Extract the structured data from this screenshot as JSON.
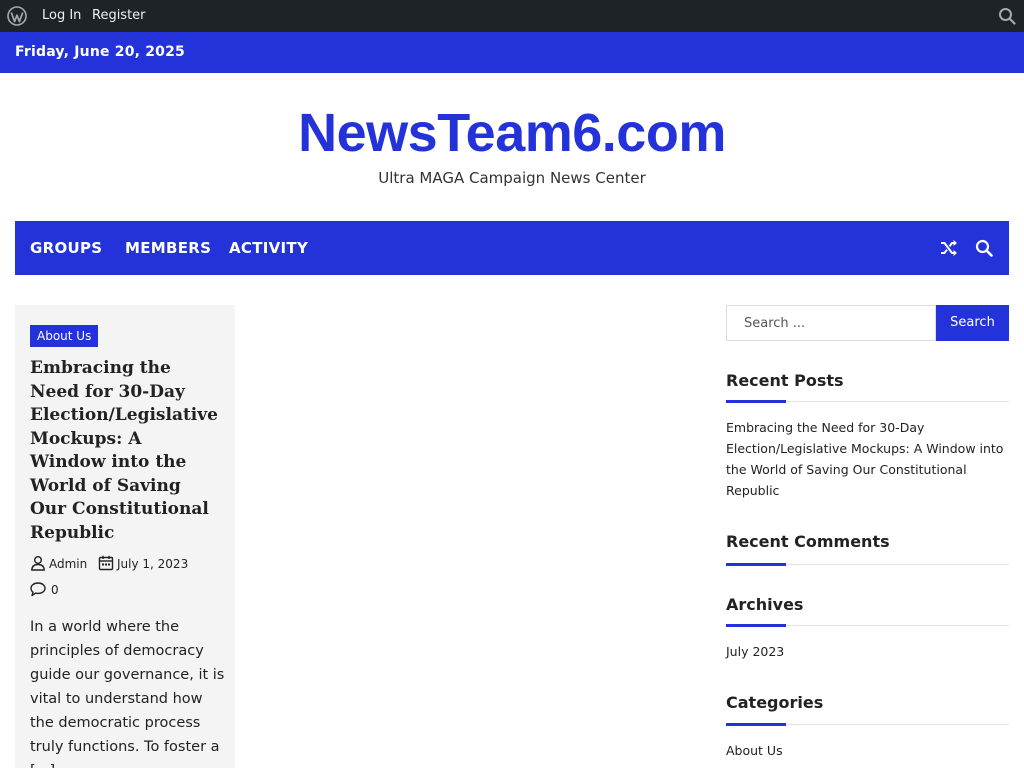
{
  "adminbar": {
    "icons": [
      "wordpress-logo-icon",
      "search-icon"
    ],
    "login": "Log In",
    "register": "Register"
  },
  "datebar": {
    "date": "Friday, June 20, 2025"
  },
  "branding": {
    "title": "NewsTeam6.com",
    "tagline": "Ultra MAGA Campaign News Center"
  },
  "nav": {
    "items": [
      "GROUPS",
      "MEMBERS",
      "ACTIVITY"
    ],
    "icons": [
      "shuffle-icon",
      "search-icon"
    ]
  },
  "post": {
    "category": "About Us",
    "title": "Embracing the Need for 30-Day Election/Legislative Mockups: A Window into the World of Saving Our Constitutional Republic",
    "author": "Admin",
    "date": "July 1, 2023",
    "comments": "0",
    "excerpt": "In a world where the principles of democracy guide our governance, it is vital to understand how the democratic process truly functions. To foster a [...]"
  },
  "sidebar": {
    "search": {
      "placeholder": "Search ...",
      "button": "Search"
    },
    "recent_posts": {
      "title": "Recent Posts",
      "items": [
        "Embracing the Need for 30-Day Election/Legislative Mockups: A Window into the World of Saving Our Constitutional Republic"
      ]
    },
    "recent_comments": {
      "title": "Recent Comments"
    },
    "archives": {
      "title": "Archives",
      "items": [
        "July 2023"
      ]
    },
    "categories": {
      "title": "Categories",
      "items": [
        "About Us"
      ]
    }
  },
  "colors": {
    "accent": "#2433d9",
    "adminbar": "#1d2327",
    "card_bg": "#f4f4f4"
  }
}
